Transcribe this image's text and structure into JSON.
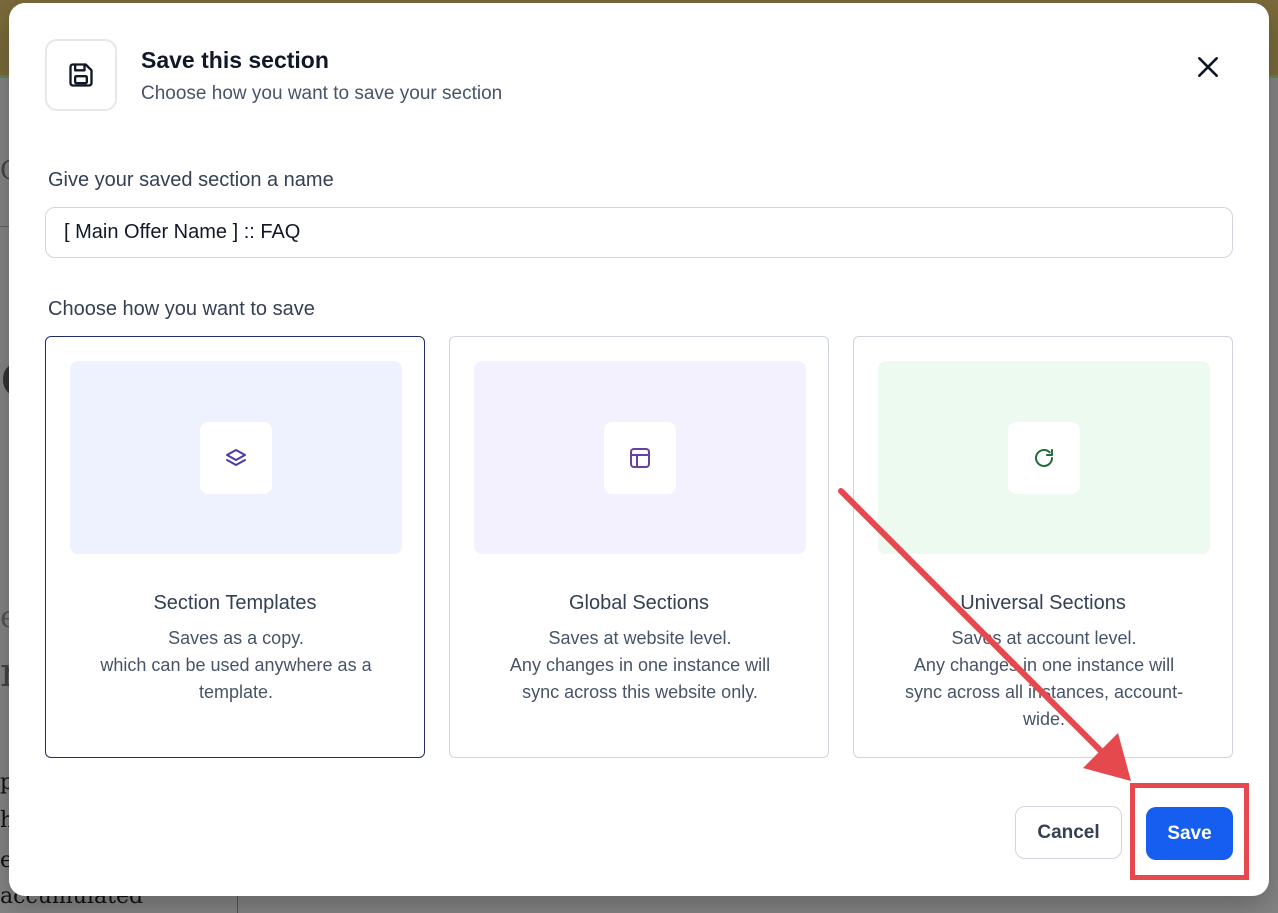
{
  "background": {
    "fragments": [
      "C",
      "e",
      "e",
      "n",
      "pe",
      "h",
      "e",
      "accumulated"
    ]
  },
  "modal": {
    "icon": "save-floppy-icon",
    "title": "Save this section",
    "subtitle": "Choose how you want to save your section",
    "close_icon": "close-icon"
  },
  "name_field": {
    "label": "Give your saved section a name",
    "value": "[ Main Offer Name ] :: FAQ"
  },
  "save_options": {
    "label": "Choose how you want to save",
    "selected_index": 0,
    "cards": [
      {
        "icon": "layers-icon",
        "title": "Section Templates",
        "description_lines": [
          "Saves as a copy.",
          "which can be used anywhere as a",
          "template."
        ]
      },
      {
        "icon": "layout-icon",
        "title": "Global Sections",
        "description_lines": [
          "Saves at website level.",
          "Any changes in one instance will",
          "sync across this website only."
        ]
      },
      {
        "icon": "refresh-icon",
        "title": "Universal Sections",
        "description_lines": [
          "Saves at account level.",
          "Any changes in one instance will",
          "sync across all instances, account-",
          "wide."
        ]
      }
    ]
  },
  "footer": {
    "cancel_label": "Cancel",
    "save_label": "Save"
  },
  "colors": {
    "primary": "#155eef",
    "annotation": "#e5484d",
    "card_1_bg": "#eef2fe",
    "card_2_bg": "#f3f1fd",
    "card_3_bg": "#ecfaf0"
  }
}
